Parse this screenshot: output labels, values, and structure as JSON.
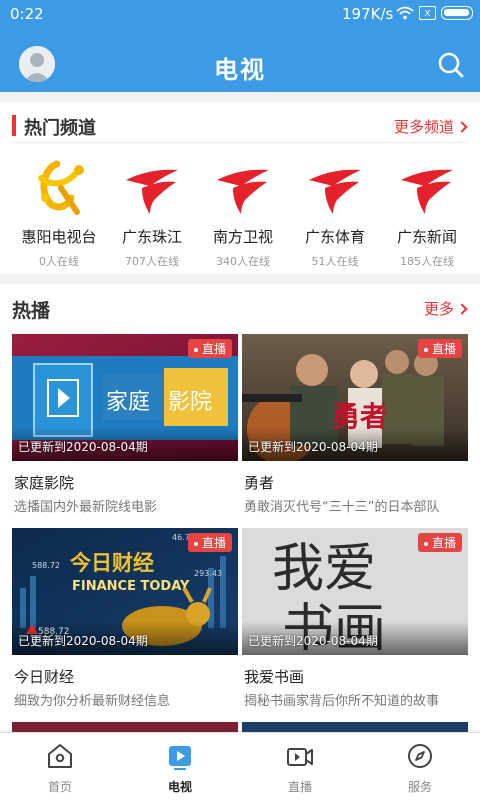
{
  "status_bar": {
    "time": "0:22",
    "speed": "197K/s",
    "x_label": "x"
  },
  "header": {
    "title": "电视"
  },
  "channels_section": {
    "title": "热门频道",
    "more": "更多频道",
    "items": [
      {
        "name": "惠阳电视台",
        "online": "0人在线",
        "logo": "huiyang-tv-logo"
      },
      {
        "name": "广东珠江",
        "online": "707人在线",
        "logo": "gdtv-logo"
      },
      {
        "name": "南方卫视",
        "online": "340人在线",
        "logo": "gdtv-logo"
      },
      {
        "name": "广东体育",
        "online": "51人在线",
        "logo": "gdtv-logo"
      },
      {
        "name": "广东新闻",
        "online": "185人在线",
        "logo": "gdtv-logo"
      }
    ]
  },
  "hot_section": {
    "title": "热播",
    "more": "更多",
    "items": [
      {
        "badge": "直播",
        "updated": "已更新到2020-08-04期",
        "title": "家庭影院",
        "desc": "选播国内外最新院线电影",
        "thumb_text": [
          "家庭",
          "影院"
        ]
      },
      {
        "badge": "直播",
        "updated": "已更新到2020-08-04期",
        "title": "勇者",
        "desc": "勇敢消灭代号“三十三”的日本部队",
        "thumb_text": [
          "勇者"
        ]
      },
      {
        "badge": "直播",
        "updated": "已更新到2020-08-04期",
        "title": "今日财经",
        "desc": "细致为你分析最新财经信息",
        "thumb_text": [
          "今日财经",
          "FINANCE TODAY",
          "588.72",
          "46.72",
          "293.43"
        ]
      },
      {
        "badge": "直播",
        "updated": "已更新到2020-08-04期",
        "title": "我爱书画",
        "desc": "揭秘书画家背后你所不知道的故事",
        "thumb_text": [
          "我爱",
          "书画"
        ]
      }
    ]
  },
  "bottom_nav": [
    {
      "label": "首页",
      "icon": "home-icon",
      "active": false
    },
    {
      "label": "电视",
      "icon": "tv-play-icon",
      "active": true
    },
    {
      "label": "直播",
      "icon": "live-camera-icon",
      "active": false
    },
    {
      "label": "服务",
      "icon": "compass-icon",
      "active": false
    }
  ],
  "colors": {
    "header_blue": "#3c9be4",
    "accent_red": "#e33",
    "badge_red": "#e64343"
  }
}
